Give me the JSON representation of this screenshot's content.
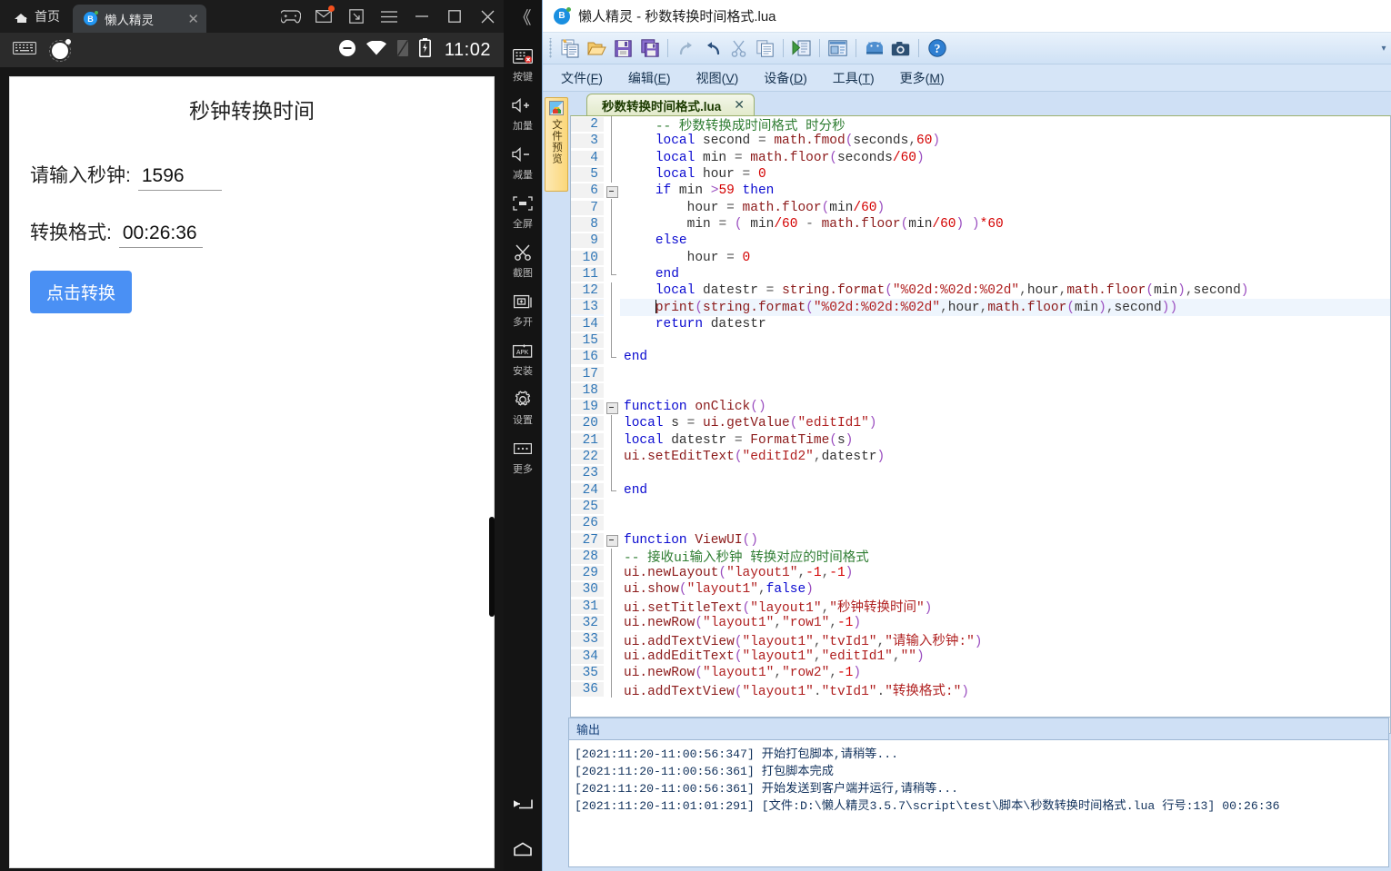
{
  "emulator": {
    "tabbar": {
      "home_label": "首页",
      "tab_title": "懒人精灵",
      "favicon_letter": "B",
      "close_label": "✕",
      "buttons": [
        {
          "name": "gamepad-icon"
        },
        {
          "name": "mail-icon"
        },
        {
          "name": "resize-icon"
        },
        {
          "name": "menu-icon"
        },
        {
          "name": "minimize-icon"
        },
        {
          "name": "maximize-icon"
        },
        {
          "name": "close-icon"
        }
      ],
      "collapse_label": "《"
    },
    "statusbar": {
      "clock": "11:02",
      "icons": [
        "keyboard-icon",
        "recording-icon",
        "dnd-icon",
        "wifi-icon",
        "sim-icon",
        "battery-charging-icon"
      ]
    },
    "app": {
      "title": "秒钟转换时间",
      "rows": [
        {
          "label": "请输入秒钟:",
          "value": "1596"
        },
        {
          "label": "转换格式:",
          "value": "00:26:36"
        }
      ],
      "button": "点击转换"
    },
    "sidebar": [
      {
        "icon": "keyboard-off-icon",
        "label": "按键"
      },
      {
        "icon": "volume-up-icon",
        "label": "加量"
      },
      {
        "icon": "volume-down-icon",
        "label": "减量"
      },
      {
        "icon": "fullscreen-icon",
        "label": "全屏"
      },
      {
        "icon": "scissors-icon",
        "label": "截图"
      },
      {
        "icon": "multi-window-icon",
        "label": "多开"
      },
      {
        "icon": "apk-install-icon",
        "label": "安装"
      },
      {
        "icon": "gear-icon",
        "label": "设置"
      },
      {
        "icon": "ellipsis-icon",
        "label": "更多"
      }
    ],
    "navbar": [
      {
        "icon": "back-icon"
      },
      {
        "icon": "home-icon"
      }
    ]
  },
  "ide": {
    "title": "懒人精灵 - 秒数转换时间格式.lua",
    "logo_letter": "B",
    "toolbar": [
      {
        "name": "new-file-icon"
      },
      {
        "name": "open-folder-icon"
      },
      {
        "name": "save-icon"
      },
      {
        "name": "save-all-icon"
      },
      {
        "name": "redo-icon"
      },
      {
        "name": "undo-icon"
      },
      {
        "name": "cut-icon"
      },
      {
        "name": "copy-icon"
      },
      {
        "name": "run-icon"
      },
      {
        "name": "ui-designer-icon"
      },
      {
        "name": "android-device-icon"
      },
      {
        "name": "screenshot-icon"
      },
      {
        "name": "help-icon"
      }
    ],
    "toolbar_overflow": "▾",
    "menu": [
      {
        "label": "文件(",
        "accel": "F",
        "tail": ")"
      },
      {
        "label": "编辑(",
        "accel": "E",
        "tail": ")"
      },
      {
        "label": "视图(",
        "accel": "V",
        "tail": ")"
      },
      {
        "label": "设备(",
        "accel": "D",
        "tail": ")"
      },
      {
        "label": "工具(",
        "accel": "T",
        "tail": ")"
      },
      {
        "label": "更多(",
        "accel": "M",
        "tail": ")"
      }
    ],
    "side_vtab": "文件预览",
    "file_tab": {
      "name": "秒数转换时间格式.lua",
      "close": "✕"
    },
    "hscroll": {
      "left_arrow": "❮"
    },
    "output": {
      "header": "输出",
      "lines": [
        "[2021:11:20-11:00:56:347] 开始打包脚本,请稍等...",
        "[2021:11:20-11:00:56:361] 打包脚本完成",
        "[2021:11:20-11:00:56:361] 开始发送到客户端并运行,请稍等...",
        "[2021:11:20-11:01:01:291] [文件:D:\\懒人精灵3.5.7\\script\\test\\脚本\\秒数转换时间格式.lua 行号:13] 00:26:36"
      ]
    },
    "code_lines": [
      {
        "n": "2",
        "fold": "bar",
        "html": "<span class=\"ind\">    </span><span class=\"cm\">-- 秒数转换成时间格式 时分秒</span>"
      },
      {
        "n": "3",
        "fold": "bar",
        "html": "<span class=\"ind\">    </span><span class=\"kw\">local</span> <span class=\"id\">second</span> <span class=\"op\">=</span> <span class=\"fn\">math.fmod</span><span class=\"par\">(</span><span class=\"id\">seconds</span><span class=\"op\">,</span><span class=\"num\">60</span><span class=\"par\">)</span>"
      },
      {
        "n": "4",
        "fold": "bar",
        "html": "<span class=\"ind\">    </span><span class=\"kw\">local</span> <span class=\"id\">min</span> <span class=\"op\">=</span> <span class=\"fn\">math.floor</span><span class=\"par\">(</span><span class=\"id\">seconds</span><span class=\"num\">/60</span><span class=\"par\">)</span>"
      },
      {
        "n": "5",
        "fold": "bar",
        "html": "<span class=\"ind\">    </span><span class=\"kw\">local</span> <span class=\"id\">hour</span> <span class=\"op\">=</span> <span class=\"num\">0</span>"
      },
      {
        "n": "6",
        "fold": "box",
        "html": "<span class=\"ind\">    </span><span class=\"kw\">if</span> <span class=\"id\">min</span> <span class=\"par\">&gt;</span><span class=\"num\">59</span> <span class=\"kw\">then</span>"
      },
      {
        "n": "7",
        "fold": "bar2",
        "html": "<span class=\"ind\">        </span><span class=\"id\">hour</span> <span class=\"op\">=</span> <span class=\"fn\">math.floor</span><span class=\"par\">(</span><span class=\"id\">min</span><span class=\"num\">/60</span><span class=\"par\">)</span>"
      },
      {
        "n": "8",
        "fold": "bar2",
        "html": "<span class=\"ind\">        </span><span class=\"id\">min</span> <span class=\"op\">=</span> <span class=\"par\">(</span> <span class=\"id\">min</span><span class=\"num\">/60</span> <span class=\"op\">-</span> <span class=\"fn\">math.floor</span><span class=\"par\">(</span><span class=\"id\">min</span><span class=\"num\">/60</span><span class=\"par\">)</span> <span class=\"par\">)</span><span class=\"num\">*60</span>"
      },
      {
        "n": "9",
        "fold": "bar",
        "html": "<span class=\"ind\">    </span><span class=\"kw\">else</span>"
      },
      {
        "n": "10",
        "fold": "bar2",
        "html": "<span class=\"ind\">        </span><span class=\"id\">hour</span> <span class=\"op\">=</span> <span class=\"num\">0</span>"
      },
      {
        "n": "11",
        "fold": "endL",
        "html": "<span class=\"ind\">    </span><span class=\"kw\">end</span>"
      },
      {
        "n": "12",
        "fold": "bar",
        "html": "<span class=\"ind\">    </span><span class=\"kw\">local</span> <span class=\"id\">datestr</span> <span class=\"op\">=</span> <span class=\"fn\">string.format</span><span class=\"par\">(</span><span class=\"str\">\"%02d:%02d:%02d\"</span><span class=\"op\">,</span><span class=\"id\">hour</span><span class=\"op\">,</span><span class=\"fn\">math.floor</span><span class=\"par\">(</span><span class=\"id\">min</span><span class=\"par\">)</span><span class=\"op\">,</span><span class=\"id\">second</span><span class=\"par\">)</span>"
      },
      {
        "n": "13",
        "fold": "bar",
        "hl": true,
        "html": "<span class=\"ind\">    </span><span class=\"caret\"></span><span class=\"fn\">print</span><span class=\"par\">(</span><span class=\"fn\">string.format</span><span class=\"par\">(</span><span class=\"str\">\"%02d:%02d:%02d\"</span><span class=\"op\">,</span><span class=\"id\">hour</span><span class=\"op\">,</span><span class=\"fn\">math.floor</span><span class=\"par\">(</span><span class=\"id\">min</span><span class=\"par\">)</span><span class=\"op\">,</span><span class=\"id\">second</span><span class=\"par\">)</span><span class=\"par\">)</span>"
      },
      {
        "n": "14",
        "fold": "bar",
        "html": "<span class=\"ind\">    </span><span class=\"kw\">return</span> <span class=\"id\">datestr</span>"
      },
      {
        "n": "15",
        "fold": "bar",
        "html": ""
      },
      {
        "n": "16",
        "fold": "endL",
        "html": "<span class=\"kw\">end</span>"
      },
      {
        "n": "17",
        "fold": "",
        "html": ""
      },
      {
        "n": "18",
        "fold": "",
        "html": ""
      },
      {
        "n": "19",
        "fold": "box",
        "html": "<span class=\"kw\">function</span> <span class=\"fn\">onClick</span><span class=\"par\">()</span>"
      },
      {
        "n": "20",
        "fold": "bar",
        "html": "<span class=\"kw\">local</span> <span class=\"id\">s</span> <span class=\"op\">=</span> <span class=\"fn\">ui.getValue</span><span class=\"par\">(</span><span class=\"str\">\"editId1\"</span><span class=\"par\">)</span>"
      },
      {
        "n": "21",
        "fold": "bar",
        "html": "<span class=\"kw\">local</span> <span class=\"id\">datestr</span> <span class=\"op\">=</span> <span class=\"fn\">FormatTime</span><span class=\"par\">(</span><span class=\"id\">s</span><span class=\"par\">)</span>"
      },
      {
        "n": "22",
        "fold": "bar",
        "html": "<span class=\"fn\">ui.setEditText</span><span class=\"par\">(</span><span class=\"str\">\"editId2\"</span><span class=\"op\">,</span><span class=\"id\">datestr</span><span class=\"par\">)</span>"
      },
      {
        "n": "23",
        "fold": "bar",
        "html": ""
      },
      {
        "n": "24",
        "fold": "endL",
        "html": "<span class=\"kw\">end</span>"
      },
      {
        "n": "25",
        "fold": "",
        "html": ""
      },
      {
        "n": "26",
        "fold": "",
        "html": ""
      },
      {
        "n": "27",
        "fold": "box",
        "html": "<span class=\"kw\">function</span> <span class=\"fn\">ViewUI</span><span class=\"par\">()</span>"
      },
      {
        "n": "28",
        "fold": "bar",
        "html": "<span class=\"cm\">-- 接收ui输入秒钟 转换对应的时间格式</span>"
      },
      {
        "n": "29",
        "fold": "bar",
        "html": "<span class=\"fn\">ui.newLayout</span><span class=\"par\">(</span><span class=\"str\">\"layout1\"</span><span class=\"op\">,</span><span class=\"num\">-1</span><span class=\"op\">,</span><span class=\"num\">-1</span><span class=\"par\">)</span>"
      },
      {
        "n": "30",
        "fold": "bar",
        "html": "<span class=\"fn\">ui.show</span><span class=\"par\">(</span><span class=\"str\">\"layout1\"</span><span class=\"op\">,</span><span class=\"kw\">false</span><span class=\"par\">)</span>"
      },
      {
        "n": "31",
        "fold": "bar",
        "html": "<span class=\"fn\">ui.setTitleText</span><span class=\"par\">(</span><span class=\"str\">\"layout1\"</span><span class=\"op\">,</span><span class=\"str\">\"秒钟转换时间\"</span><span class=\"par\">)</span>"
      },
      {
        "n": "32",
        "fold": "bar",
        "html": "<span class=\"fn\">ui.newRow</span><span class=\"par\">(</span><span class=\"str\">\"layout1\"</span><span class=\"op\">,</span><span class=\"str\">\"row1\"</span><span class=\"op\">,</span><span class=\"num\">-1</span><span class=\"par\">)</span>"
      },
      {
        "n": "33",
        "fold": "bar",
        "html": "<span class=\"fn\">ui.addTextView</span><span class=\"par\">(</span><span class=\"str\">\"layout1\"</span><span class=\"op\">,</span><span class=\"str\">\"tvId1\"</span><span class=\"op\">,</span><span class=\"str\">\"请输入秒钟:\"</span><span class=\"par\">)</span>"
      },
      {
        "n": "34",
        "fold": "bar",
        "html": "<span class=\"fn\">ui.addEditText</span><span class=\"par\">(</span><span class=\"str\">\"layout1\"</span><span class=\"op\">,</span><span class=\"str\">\"editId1\"</span><span class=\"op\">,</span><span class=\"str\">\"\"</span><span class=\"par\">)</span>"
      },
      {
        "n": "35",
        "fold": "bar",
        "html": "<span class=\"fn\">ui.newRow</span><span class=\"par\">(</span><span class=\"str\">\"layout1\"</span><span class=\"op\">,</span><span class=\"str\">\"row2\"</span><span class=\"op\">,</span><span class=\"num\">-1</span><span class=\"par\">)</span>"
      },
      {
        "n": "36",
        "fold": "bar",
        "html": "<span class=\"fn\">ui.addTextView</span><span class=\"par\">(</span><span class=\"str\">\"layout1\"</span><span class=\"op\">.</span><span class=\"str\">\"tvId1\"</span><span class=\"op\">.</span><span class=\"str\">\"转换格式:\"</span><span class=\"par\">)</span>"
      }
    ]
  }
}
